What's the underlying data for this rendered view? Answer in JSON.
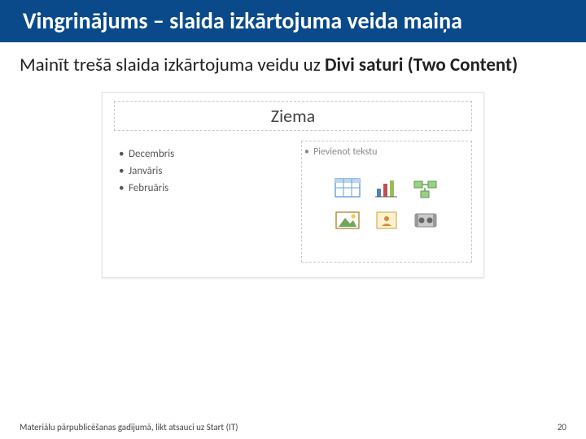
{
  "header": {
    "title": "Vingrinājums – slaida izkārtojuma veida maiņa"
  },
  "body": {
    "instruction_plain": "Mainīt trešā slaida izkārtojuma veidu uz ",
    "instruction_bold": "Divi saturi (Two Content)"
  },
  "figure": {
    "slide_title": "Ziema",
    "left_bullets": [
      "Decembris",
      "Janvāris",
      "Februāris"
    ],
    "right_placeholder": "Pievienot tekstu",
    "icons": {
      "table": "table-icon",
      "chart": "chart-icon",
      "smartart": "smartart-icon",
      "picture": "picture-icon",
      "clipart": "clipart-icon",
      "media": "media-icon"
    }
  },
  "footer": {
    "note": "Materiālu pārpublicēšanas gadījumā, likt atsauci uz Start (IT)",
    "page": "20"
  }
}
